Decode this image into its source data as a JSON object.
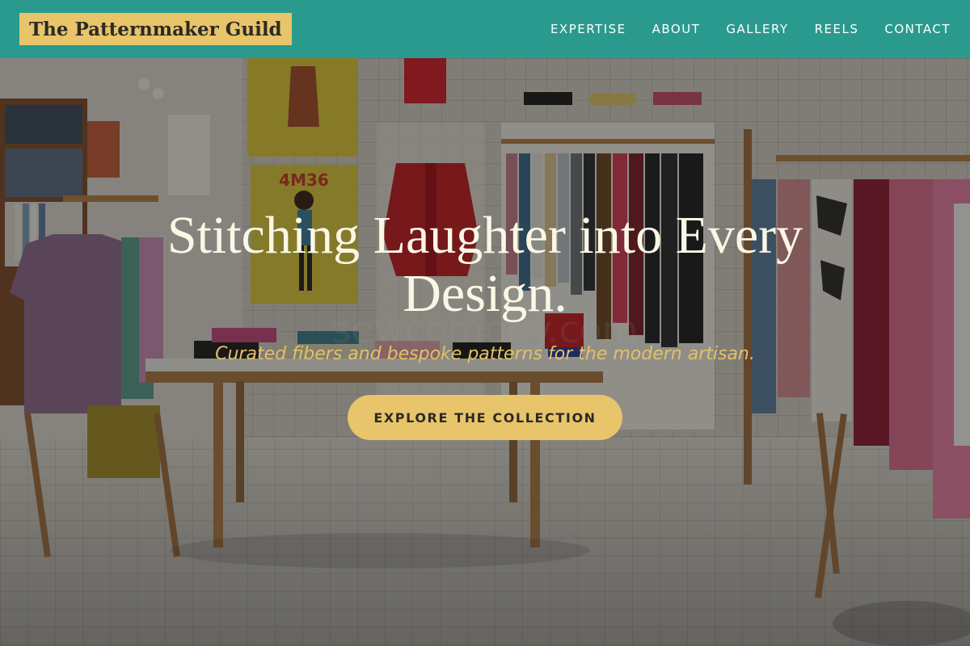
{
  "header": {
    "logo_text": "The Patternmaker Guild",
    "nav": [
      {
        "label": "EXPERTISE"
      },
      {
        "label": "ABOUT"
      },
      {
        "label": "GALLERY"
      },
      {
        "label": "REELS"
      },
      {
        "label": "CONTACT"
      }
    ]
  },
  "hero": {
    "headline": "Stitching Laughter into Every Design.",
    "tagline": "Curated fibers and bespoke patterns for the modern artisan.",
    "cta_label": "EXPLORE THE COLLECTION",
    "poster_text": "4M36",
    "watermark": "sewcomedy.com"
  },
  "colors": {
    "header_bg": "#2a9a8e",
    "accent_gold": "#e8c46a",
    "headline": "#fbf7e6",
    "tagline": "#e3c169"
  }
}
